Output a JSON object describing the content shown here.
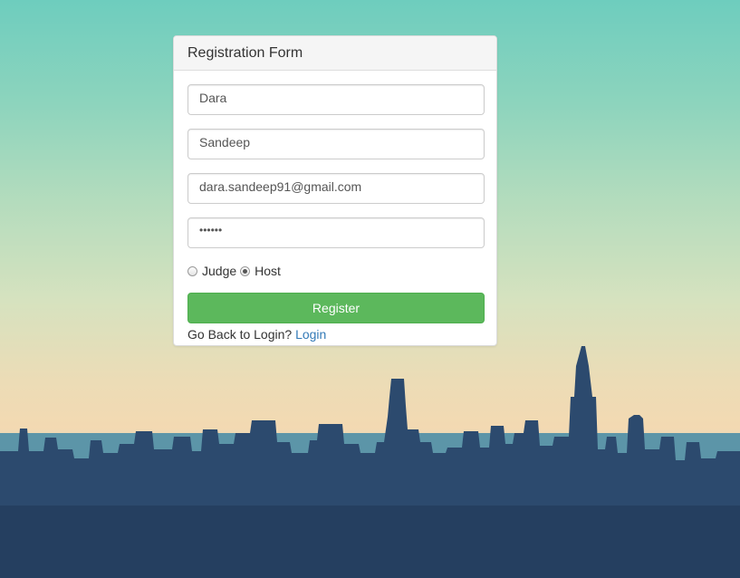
{
  "form": {
    "title": "Registration Form",
    "first_name_value": "Dara",
    "last_name_value": "Sandeep",
    "email_value": "dara.sandeep91@gmail.com",
    "password_value": "••••••",
    "role_options": [
      "Judge",
      "Host"
    ],
    "selected_role": "Host",
    "register_label": "Register",
    "back_prompt": "Go Back to Login?",
    "login_link_label": "Login"
  },
  "colors": {
    "button": "#5cb85c",
    "link": "#337ab7"
  }
}
